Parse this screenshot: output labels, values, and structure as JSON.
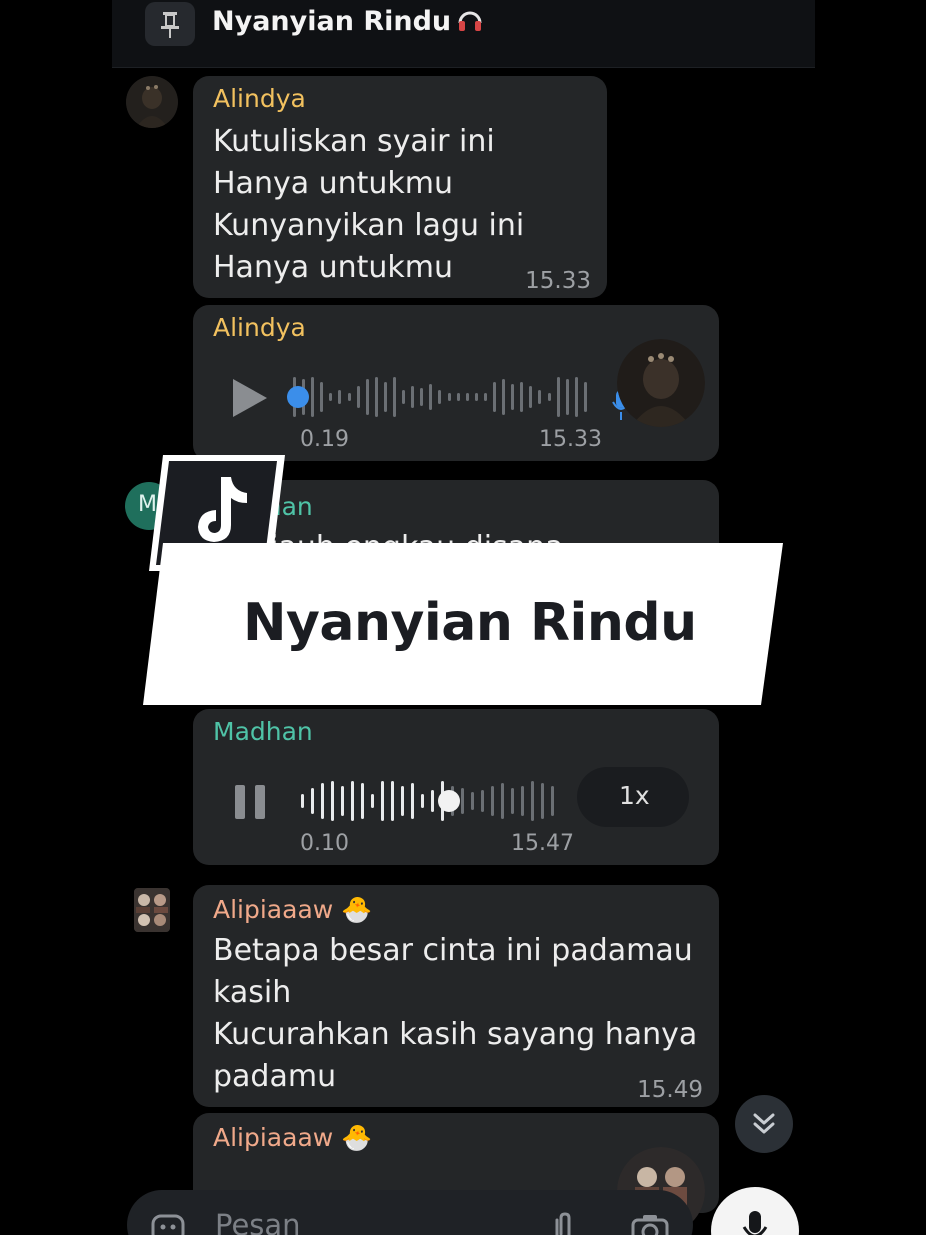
{
  "header": {
    "title": "Nyanyian Rindu",
    "icon": "headphones-icon"
  },
  "messages": [
    {
      "sender": "Alindya",
      "lines": [
        "Kutuliskan syair ini",
        "Hanya untukmu",
        "Kunyanyikan lagu ini",
        "Hanya untukmu"
      ],
      "time": "15.33"
    },
    {
      "sender": "Alindya",
      "voice": {
        "elapsed": "0.19",
        "duration": "15.33",
        "progress": 0.0
      },
      "time": ""
    },
    {
      "sender": "Madhan",
      "partial_text": "...u jauh engkau disana"
    },
    {
      "sender": "Madhan",
      "voice": {
        "elapsed": "0.10",
        "duration": "15.47",
        "progress": 0.57,
        "speed": "1x"
      }
    },
    {
      "sender": "Alipiaaaw 🐣",
      "lines": [
        "Betapa besar cinta ini padamau",
        "kasih",
        "Kucurahkan kasih sayang hanya",
        "padamu"
      ],
      "time": "15.49"
    },
    {
      "sender": "Alipiaaaw 🐣"
    }
  ],
  "overlay": {
    "banner_text": "Nyanyian Rindu",
    "logo": "tiktok-logo"
  },
  "composer": {
    "placeholder": "Pesan",
    "icons": [
      "emoji-icon",
      "attach-icon",
      "camera-icon",
      "mic-icon"
    ]
  },
  "colors": {
    "background": "#000000",
    "bubble": "#242628",
    "alindya": "#f2c15f",
    "madhan": "#4fc3a7",
    "alipiaaaw": "#f0a98a",
    "accent_blue": "#3b8eea"
  }
}
